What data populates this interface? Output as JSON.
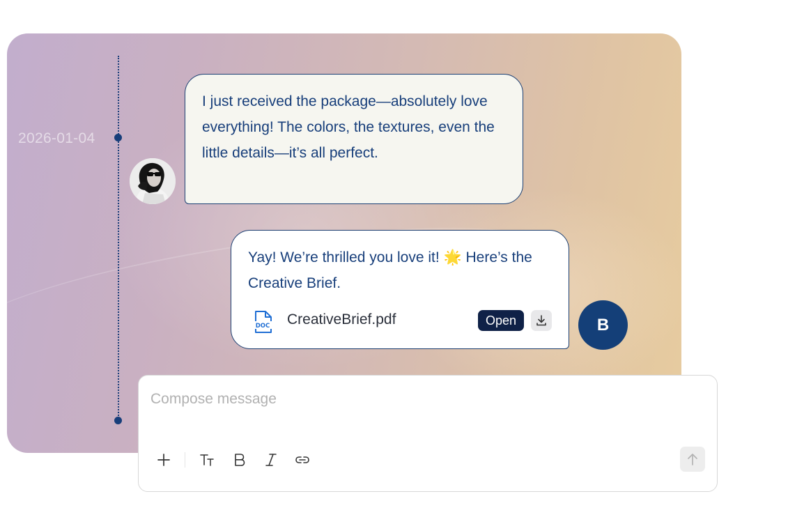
{
  "conversation": {
    "date": "2026-01-04",
    "incoming": {
      "text": "I just received the package—absolutely love everything! The colors, the textures, even the little details—it’s all perfect."
    },
    "outgoing": {
      "text": "Yay! We’re thrilled you love it! 🌟 Here’s the Creative Brief.",
      "attachment": {
        "file_name": "CreativeBrief.pdf",
        "icon_label": "DOC",
        "open_label": "Open"
      },
      "avatar_initial": "B"
    }
  },
  "composer": {
    "placeholder": "Compose message",
    "tools": [
      "add-icon",
      "text-size-icon",
      "bold-icon",
      "italic-icon",
      "link-icon"
    ]
  },
  "colors": {
    "accent": "#143f78",
    "text": "#173e7a",
    "open_button": "#0f2147"
  }
}
